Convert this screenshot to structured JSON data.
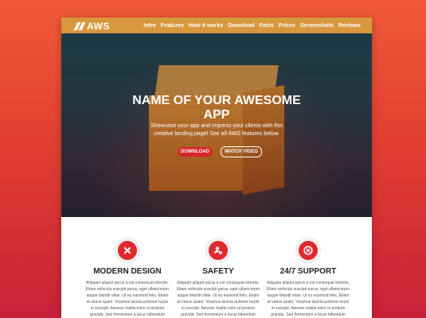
{
  "brand": {
    "logo_text": "AWS"
  },
  "nav": {
    "items": [
      "Intro",
      "Features",
      "How it works",
      "Download",
      "Facts",
      "Prices",
      "Screenshots",
      "Reviews"
    ]
  },
  "hero": {
    "title_line1": "NAME OF YOUR AWESOME",
    "title_line2": "APP",
    "description": "Showcase your app and impress your clients with this creative landing page! See all AWS features below.",
    "download_label": "DOWNLOAD",
    "watch_label": "WATCH VIDEO"
  },
  "features": [
    {
      "icon": "x-icon",
      "title": "MODERN DESIGN",
      "text": "Aliquam aliquet purus a est consequat lobortis. Etiam vehicula suscipit purus, eget ullamcorper augue blandit vitae. Ut eu euismod felis. Etiam at varius quam. Vivamus lacinia pulvinar turpis in suscipit. Aenean mattis enim ut pretium gravida. Sed fermentum a lacus bibendum convallis."
    },
    {
      "icon": "user-gear-icon",
      "title": "SAFETY",
      "text": "Aliquam aliquet purus a est consequat lobortis. Etiam vehicula suscipit purus, eget ullamcorper augue blandit vitae. Ut eu euismod felis. Etiam at varius quam. Vivamus lacinia pulvinar turpis in suscipit. Aenean mattis enim ut pretium gravida. Sed fermentum a lacus bibendum convallis."
    },
    {
      "icon": "support-icon",
      "title": "24/7 SUPPORT",
      "text": "Aliquam aliquet purus a est consequat lobortis. Etiam vehicula suscipit purus, eget ullamcorper augue blandit vitae. Ut eu euismod felis. Etiam at varius quam. Vivamus lacinia pulvinar turpis in suscipit. Aenean mattis enim ut pretium gravida. Sed fermentum a lacus bibendum convallis."
    }
  ],
  "colors": {
    "background_top": "#ef5a36",
    "background_bottom": "#c72238",
    "navbar": "#d8973c",
    "accent": "#d6262c"
  }
}
